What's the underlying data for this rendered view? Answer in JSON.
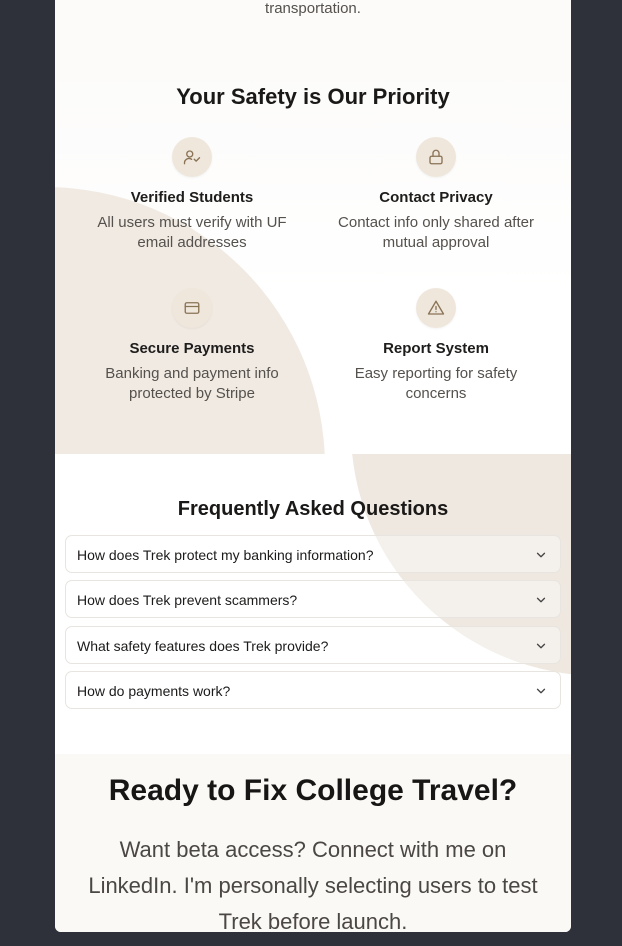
{
  "intro": {
    "tail_text": "transportation."
  },
  "safety": {
    "title": "Your Safety is Our Priority",
    "features": [
      {
        "icon": "user-check-icon",
        "title": "Verified Students",
        "desc": "All users must verify with UF email addresses"
      },
      {
        "icon": "lock-icon",
        "title": "Contact Privacy",
        "desc": "Contact info only shared after mutual approval"
      },
      {
        "icon": "credit-card-icon",
        "title": "Secure Payments",
        "desc": "Banking and payment info protected by Stripe"
      },
      {
        "icon": "alert-triangle-icon",
        "title": "Report System",
        "desc": "Easy reporting for safety concerns"
      }
    ]
  },
  "faq": {
    "title": "Frequently Asked Questions",
    "items": [
      {
        "question": "How does Trek protect my banking information?"
      },
      {
        "question": "How does Trek prevent scammers?"
      },
      {
        "question": "What safety features does Trek provide?"
      },
      {
        "question": "How do payments work?"
      }
    ]
  },
  "cta": {
    "title": "Ready to Fix College Travel?",
    "text": "Want beta access? Connect with me on LinkedIn. I'm personally selecting users to test Trek before launch."
  },
  "colors": {
    "accent": "#8a7355",
    "icon_bg": "#efe7dc",
    "blob": "#ede6dd",
    "outer_bg": "#2e313a"
  }
}
